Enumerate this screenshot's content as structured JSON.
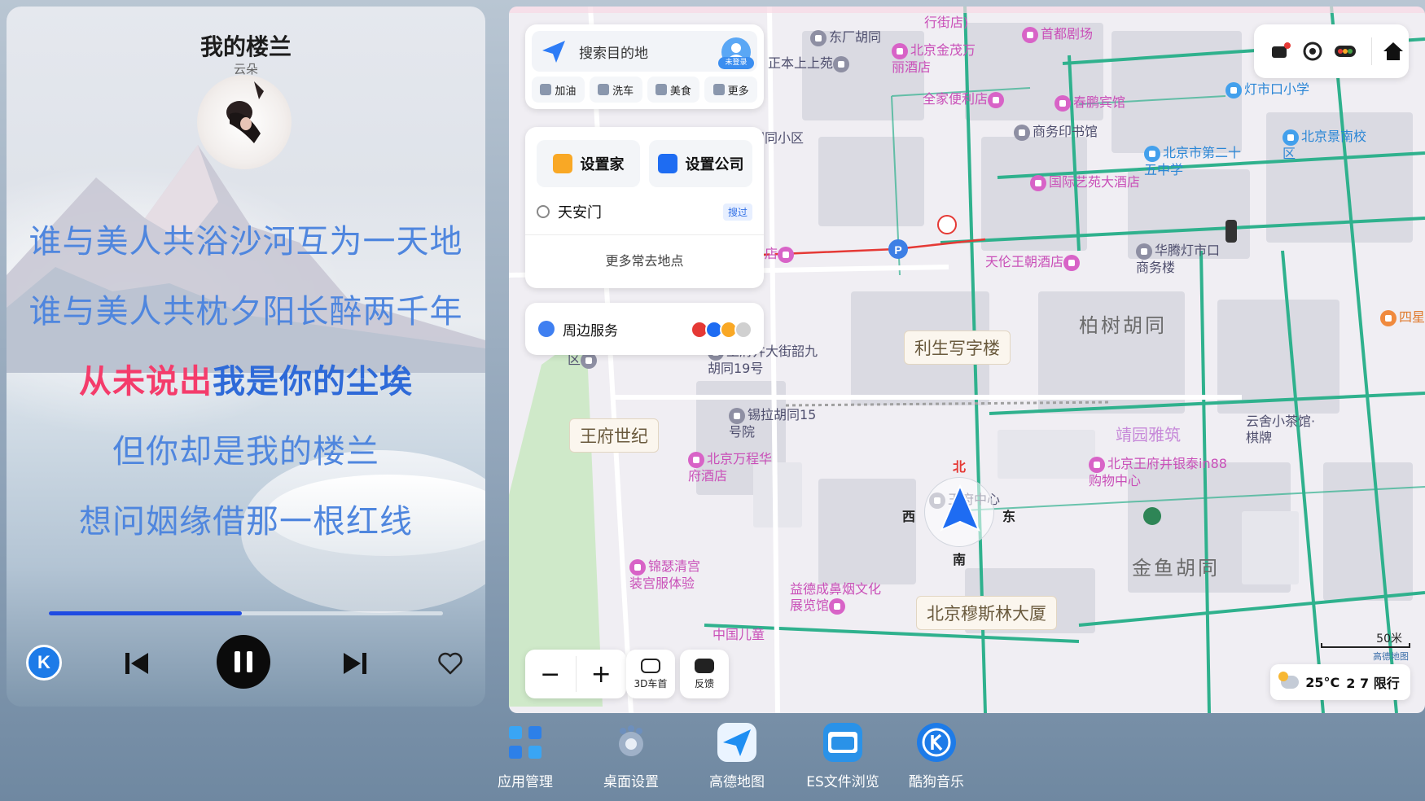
{
  "music": {
    "title": "我的楼兰",
    "artist": "云朵",
    "progress": 0.49,
    "lyrics": [
      {
        "text": "谁与美人共浴沙河互为一天地"
      },
      {
        "text": "谁与美人共枕夕阳长醉两千年"
      },
      {
        "sung": "从未说出",
        "unsung": "我是你的尘埃"
      },
      {
        "text": "但你却是我的楼兰"
      },
      {
        "text": "想问姻缘借那一根红线"
      }
    ],
    "controls": {
      "app_icon": "kugou-k-icon",
      "app_glyph": "K",
      "prev": "skip-previous-icon",
      "play_state": "pause-icon",
      "next": "skip-next-icon",
      "like": "heart-outline-icon"
    }
  },
  "map": {
    "search": {
      "placeholder": "搜索目的地",
      "login_tag": "未登录",
      "quick": [
        "加油",
        "洗车",
        "美食",
        "更多"
      ]
    },
    "favorites": {
      "home": "设置家",
      "company": "设置公司",
      "recent": "天安门",
      "recent_tag": "搜过",
      "more": "更多常去地点"
    },
    "nearby": {
      "label": "周边服务"
    },
    "tools": {
      "zoom_out": "−",
      "zoom_in": "+",
      "car_heading": "3D车首",
      "feedback": "反馈"
    },
    "weather": {
      "temp": "25°C",
      "restriction": "2 7 限行"
    },
    "scale": "50米",
    "brand": "高德地图",
    "compass": {
      "n": "北",
      "s": "南",
      "e": "东",
      "w": "西"
    },
    "pois": {
      "p1": "东厂胡同",
      "p2": "首都剧场",
      "p3": "北京金茂万丽酒店",
      "p4": "正本上上苑",
      "p5": "全家便利店",
      "p6": "春鹏宾馆",
      "p7": "灯市口小学",
      "p8": "商务印书馆",
      "p9": "北京市第二十五中学",
      "p10": "北京景南校区",
      "p11": "国际艺苑大酒店",
      "p12": "广胡同小区",
      "p13": "华饭店",
      "p14": "天伦王朝酒店",
      "p15": "华腾灯市口商务楼",
      "p16": "柏树胡同",
      "p17": "四星",
      "p18": "利生写字楼",
      "p19": "东黄城根南街小区南区",
      "p20": "王府井大街韶九胡同19号",
      "p21": "锡拉胡同15号院",
      "p22": "王府世纪",
      "p23": "北京万程华府酒店",
      "p24": "靖园雅筑",
      "p25": "云舍小茶馆·棋牌",
      "p26": "北京王府井银泰in88购物中心",
      "p27": "王府中心",
      "p28": "锦瑟清宫装宫服体验",
      "p29": "益德成鼻烟文化展览馆",
      "p30": "北京穆斯林大厦",
      "p31": "金鱼胡同",
      "p32": "中国儿童",
      "p33": "东厂胡同",
      "p34": "行街店)"
    }
  },
  "dock": [
    {
      "label": "应用管理",
      "icon": "app-manage-icon"
    },
    {
      "label": "桌面设置",
      "icon": "desktop-settings-icon"
    },
    {
      "label": "高德地图",
      "icon": "amap-icon"
    },
    {
      "label": "ES文件浏览",
      "icon": "es-file-icon"
    },
    {
      "label": "酷狗音乐",
      "icon": "kugou-icon"
    }
  ],
  "colors": {
    "lyric": "#4f86de",
    "lyric_sung": "#f43c6b",
    "progress": "#1f4be2",
    "map_road": "#2fb18d",
    "map_bg": "#f0eef3"
  }
}
